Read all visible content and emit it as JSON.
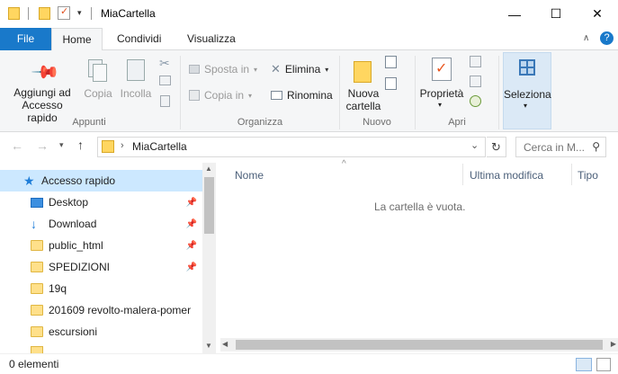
{
  "window": {
    "title": "MiaCartella",
    "buttons": {
      "minimize": "—",
      "maximize": "☐",
      "close": "✕"
    }
  },
  "tabs": {
    "file": "File",
    "home": "Home",
    "share": "Condividi",
    "view": "Visualizza"
  },
  "ribbon": {
    "groups": {
      "clipboard": "Appunti",
      "organize": "Organizza",
      "new": "Nuovo",
      "open": "Apri"
    },
    "pin_label_1": "Aggiungi ad",
    "pin_label_2": "Accesso rapido",
    "copy": "Copia",
    "paste": "Incolla",
    "move_to": "Sposta in",
    "copy_to": "Copia in",
    "delete": "Elimina",
    "rename": "Rinomina",
    "new_folder_1": "Nuova",
    "new_folder_2": "cartella",
    "properties": "Proprietà",
    "select": "Seleziona"
  },
  "address": {
    "path": "MiaCartella",
    "search_placeholder": "Cerca in M..."
  },
  "nav": {
    "items": [
      {
        "label": "Accesso rapido",
        "pinned": false
      },
      {
        "label": "Desktop",
        "pinned": true
      },
      {
        "label": "Download",
        "pinned": true
      },
      {
        "label": "public_html",
        "pinned": true
      },
      {
        "label": "SPEDIZIONI",
        "pinned": true
      },
      {
        "label": "19q",
        "pinned": false
      },
      {
        "label": "201609 revolto-malera-pomer",
        "pinned": false
      },
      {
        "label": "escursioni",
        "pinned": false
      }
    ]
  },
  "content": {
    "columns": {
      "name": "Nome",
      "modified": "Ultima modifica",
      "type": "Tipo"
    },
    "empty_message": "La cartella è vuota."
  },
  "status": {
    "count": "0 elementi"
  },
  "colors": {
    "accent": "#1979ca",
    "selection": "#cce8ff"
  }
}
